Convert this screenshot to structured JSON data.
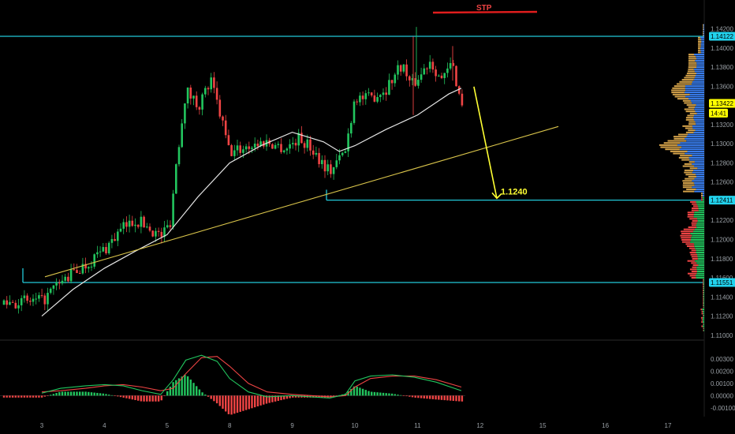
{
  "chart_data": [
    {
      "type": "candlestick",
      "title": "",
      "x_ticks": [
        "3",
        "4",
        "5",
        "8",
        "9",
        "10",
        "11",
        "12",
        "15",
        "16",
        "17"
      ],
      "y_ticks": [
        "1.14200",
        "1.14000",
        "1.13800",
        "1.13600",
        "1.13400",
        "1.13200",
        "1.13000",
        "1.12800",
        "1.12600",
        "1.12400",
        "1.12200",
        "1.12000",
        "1.11800",
        "1.11600",
        "1.11400",
        "1.11200",
        "1.11000"
      ],
      "ylim": [
        1.1097,
        1.1432
      ],
      "price_tags": [
        {
          "label": "1.14122",
          "value": 1.14122,
          "color": "#22d3ee"
        },
        {
          "label": "1.13422",
          "value": 1.13422,
          "color": "#ffff00"
        },
        {
          "label": "14:41",
          "value": 1.1332,
          "color": "#ffff00"
        },
        {
          "label": "1.12411",
          "value": 1.12411,
          "color": "#22d3ee"
        },
        {
          "label": "1.11551",
          "value": 1.11551,
          "color": "#22d3ee"
        }
      ],
      "horizontal_levels": [
        1.14122,
        1.12411,
        1.11551
      ],
      "annotations": {
        "stop_label": "STP",
        "target_label": "1.1240"
      },
      "close_path": [
        {
          "x": 0,
          "close": 1.1135
        },
        {
          "x": 0.25,
          "close": 1.1152
        },
        {
          "x": 0.5,
          "close": 1.1165
        },
        {
          "x": 0.75,
          "close": 1.1176
        },
        {
          "x": 1.0,
          "close": 1.119
        },
        {
          "x": 1.3,
          "close": 1.1212
        },
        {
          "x": 1.5,
          "close": 1.1221
        },
        {
          "x": 1.7,
          "close": 1.1213
        },
        {
          "x": 1.9,
          "close": 1.1203
        },
        {
          "x": 2.05,
          "close": 1.1218
        },
        {
          "x": 2.15,
          "close": 1.1282
        },
        {
          "x": 2.3,
          "close": 1.1356
        },
        {
          "x": 2.5,
          "close": 1.134
        },
        {
          "x": 2.7,
          "close": 1.1365
        },
        {
          "x": 2.85,
          "close": 1.133
        },
        {
          "x": 3.0,
          "close": 1.129
        },
        {
          "x": 3.3,
          "close": 1.1298
        },
        {
          "x": 3.6,
          "close": 1.1302
        },
        {
          "x": 3.9,
          "close": 1.1295
        },
        {
          "x": 4.1,
          "close": 1.1306
        },
        {
          "x": 4.3,
          "close": 1.1296
        },
        {
          "x": 4.6,
          "close": 1.1271
        },
        {
          "x": 4.85,
          "close": 1.1293
        },
        {
          "x": 5.0,
          "close": 1.135
        },
        {
          "x": 5.2,
          "close": 1.1346
        },
        {
          "x": 5.5,
          "close": 1.1358
        },
        {
          "x": 5.75,
          "close": 1.1384
        },
        {
          "x": 5.9,
          "close": 1.136
        },
        {
          "x": 6.05,
          "close": 1.1372
        },
        {
          "x": 6.2,
          "close": 1.1388
        },
        {
          "x": 6.4,
          "close": 1.1365
        },
        {
          "x": 6.55,
          "close": 1.1385
        },
        {
          "x": 6.7,
          "close": 1.1342
        }
      ],
      "ma_path": [
        {
          "x": 0,
          "value": 1.112
        },
        {
          "x": 0.5,
          "value": 1.1148
        },
        {
          "x": 1.0,
          "value": 1.117
        },
        {
          "x": 1.5,
          "value": 1.1188
        },
        {
          "x": 2.0,
          "value": 1.1205
        },
        {
          "x": 2.5,
          "value": 1.1245
        },
        {
          "x": 3.0,
          "value": 1.128
        },
        {
          "x": 3.5,
          "value": 1.1298
        },
        {
          "x": 4.0,
          "value": 1.1312
        },
        {
          "x": 4.5,
          "value": 1.1302
        },
        {
          "x": 4.75,
          "value": 1.1292
        },
        {
          "x": 5.0,
          "value": 1.1298
        },
        {
          "x": 5.5,
          "value": 1.1315
        },
        {
          "x": 6.0,
          "value": 1.133
        },
        {
          "x": 6.5,
          "value": 1.1352
        },
        {
          "x": 6.7,
          "value": 1.1358
        }
      ],
      "trendline": [
        {
          "x": 0.05,
          "value": 1.1161
        },
        {
          "x": 8.25,
          "value": 1.1318
        }
      ],
      "projection": [
        {
          "x": 6.8,
          "value": 1.1358
        },
        {
          "x": 7.2,
          "value": 1.1243
        }
      ],
      "volume_profile": {
        "up_color": "#3b82f6",
        "down_color": "#d4a24a",
        "lower_up_color": "#22c55e",
        "lower_down_color": "#ef4444"
      }
    },
    {
      "type": "macd",
      "y_ticks": [
        "0.00300",
        "0.00200",
        "0.00100",
        "0.00000",
        "-0.00100"
      ],
      "ylim": [
        -0.0013,
        0.0037
      ],
      "macd_line": [
        {
          "x": 0,
          "value": 0.0002
        },
        {
          "x": 0.3,
          "value": 0.0006
        },
        {
          "x": 0.7,
          "value": 0.0008
        },
        {
          "x": 1.0,
          "value": 0.0009
        },
        {
          "x": 1.3,
          "value": 0.0008
        },
        {
          "x": 1.6,
          "value": 0.0004
        },
        {
          "x": 1.9,
          "value": 0.0001
        },
        {
          "x": 2.1,
          "value": 0.0013
        },
        {
          "x": 2.3,
          "value": 0.0029
        },
        {
          "x": 2.55,
          "value": 0.0033
        },
        {
          "x": 2.8,
          "value": 0.0028
        },
        {
          "x": 3.0,
          "value": 0.0014
        },
        {
          "x": 3.3,
          "value": 0.0003
        },
        {
          "x": 3.6,
          "value": -0.0001
        },
        {
          "x": 4.0,
          "value": 0.0
        },
        {
          "x": 4.3,
          "value": -0.0001
        },
        {
          "x": 4.6,
          "value": -0.0002
        },
        {
          "x": 4.85,
          "value": 0.0001
        },
        {
          "x": 5.0,
          "value": 0.0012
        },
        {
          "x": 5.25,
          "value": 0.0016
        },
        {
          "x": 5.6,
          "value": 0.0017
        },
        {
          "x": 5.95,
          "value": 0.0015
        },
        {
          "x": 6.3,
          "value": 0.0011
        },
        {
          "x": 6.7,
          "value": 0.0004
        }
      ],
      "signal_line": [
        {
          "x": 0,
          "value": 0.0003
        },
        {
          "x": 0.3,
          "value": 0.0004
        },
        {
          "x": 0.7,
          "value": 0.0006
        },
        {
          "x": 1.0,
          "value": 0.0008
        },
        {
          "x": 1.3,
          "value": 0.0009
        },
        {
          "x": 1.6,
          "value": 0.0007
        },
        {
          "x": 1.9,
          "value": 0.0004
        },
        {
          "x": 2.1,
          "value": 0.0006
        },
        {
          "x": 2.3,
          "value": 0.0018
        },
        {
          "x": 2.55,
          "value": 0.0031
        },
        {
          "x": 2.8,
          "value": 0.0032
        },
        {
          "x": 3.0,
          "value": 0.0024
        },
        {
          "x": 3.3,
          "value": 0.001
        },
        {
          "x": 3.6,
          "value": 0.0003
        },
        {
          "x": 4.0,
          "value": 0.0001
        },
        {
          "x": 4.3,
          "value": 0.0
        },
        {
          "x": 4.6,
          "value": -0.0001
        },
        {
          "x": 4.85,
          "value": 0.0
        },
        {
          "x": 5.0,
          "value": 0.0007
        },
        {
          "x": 5.25,
          "value": 0.0014
        },
        {
          "x": 5.6,
          "value": 0.0016
        },
        {
          "x": 5.95,
          "value": 0.0016
        },
        {
          "x": 6.3,
          "value": 0.0013
        },
        {
          "x": 6.7,
          "value": 0.0007
        }
      ],
      "colors": {
        "macd": "#22c55e",
        "signal": "#ef4444",
        "hist_up": "#22c55e",
        "hist_down": "#ef4444"
      }
    }
  ]
}
